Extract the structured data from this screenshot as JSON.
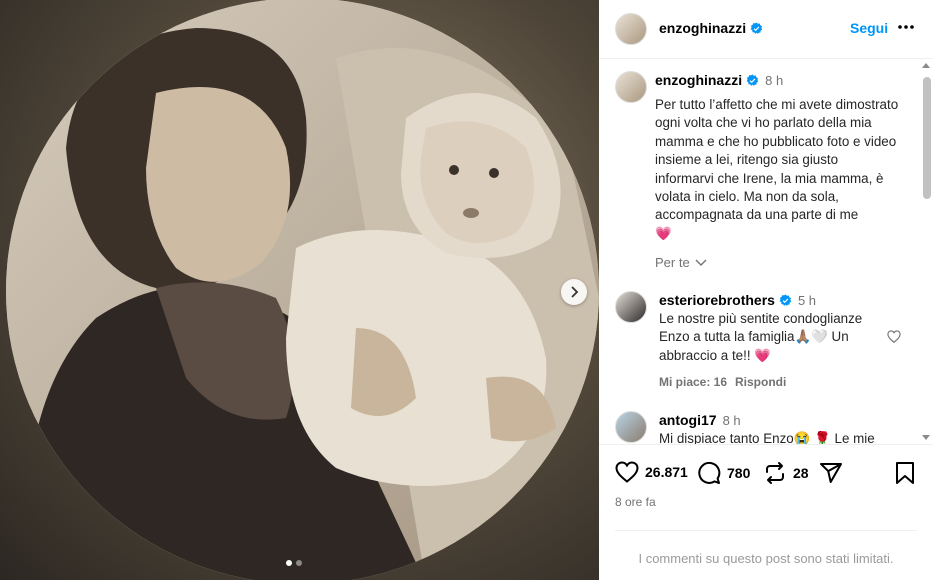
{
  "post": {
    "author": "enzoghinazzi",
    "follow_label": "Segui",
    "caption_time": "8 h",
    "caption": "Per tutto l’affetto che mi avete dimostrato ogni volta che vi ho parlato della mia mamma e che ho pubblicato foto e video insieme a lei, ritengo sia giusto informarvi che Irene, la mia mamma, è volata in cielo. Ma non da sola, accompagnata da una parte di me",
    "caption_emoji": "💗",
    "translate_label": "Per te"
  },
  "comments": [
    {
      "user": "esteriorebrothers",
      "time": "5 h",
      "text_line1": "Le nostre più sentite condoglianze",
      "text_line2": "Enzo a tutta la famiglia🙏🏽🤍 Un",
      "text_line3": "abbraccio a te!! 💗",
      "likes": "Mi piace: 16",
      "reply": "Rispondi"
    },
    {
      "user": "antogi17",
      "time": "8 h",
      "text": "Mi dispiace tanto Enzo😭 🌹 Le mie"
    }
  ],
  "stats": {
    "likes": "26.871",
    "comments": "780",
    "reposts": "28",
    "posted": "8 ore fa"
  },
  "footer": {
    "limited_text": "I commenti su questo post sono stati limitati."
  },
  "colors": {
    "accent": "#0095f6",
    "verified": "#0095f6",
    "like_pink": "#ed4956"
  }
}
